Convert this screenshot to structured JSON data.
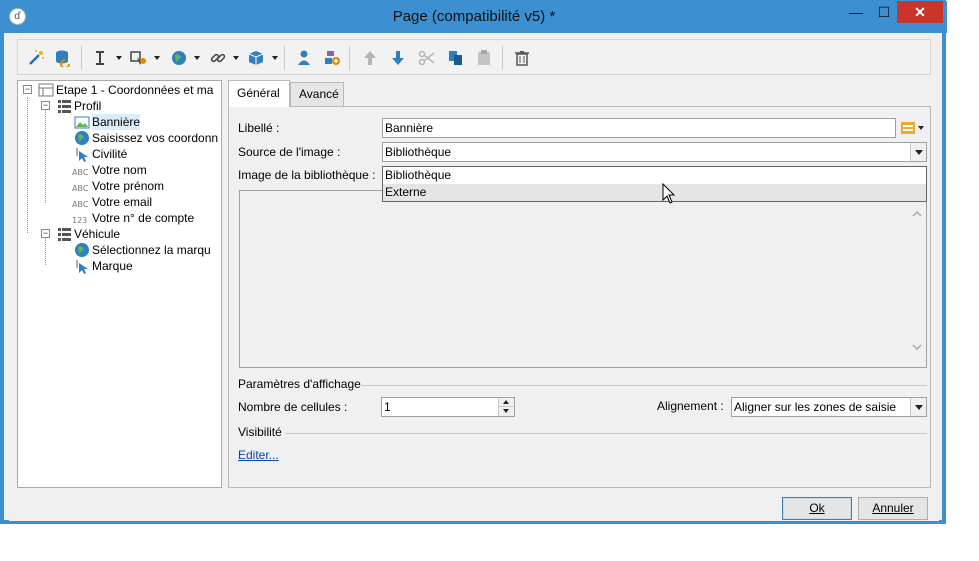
{
  "window": {
    "title": "Page (compatibilité v5) *",
    "app_icon_glyph": "ď",
    "controls": {
      "minimize": "—",
      "maximize": "☐",
      "close": "✕"
    }
  },
  "toolbar": {
    "icons": [
      "magic-wand-icon",
      "database-refresh-icon",
      "text-cursor-icon",
      "form-input-icon",
      "globe-icon",
      "link-icon",
      "box-icon",
      "user-icon",
      "add-component-icon",
      "arrow-up-icon",
      "arrow-down-icon",
      "scissors-icon",
      "copy-icon",
      "paste-icon",
      "delete-icon"
    ]
  },
  "tree": {
    "items": [
      {
        "label": "Etape 1 - Coordonnées et ma",
        "icon": "page-icon"
      },
      {
        "label": "Profil",
        "icon": "list-icon"
      },
      {
        "label": "Bannière",
        "icon": "image-icon"
      },
      {
        "label": "Saisissez vos coordonn",
        "icon": "globe-icon"
      },
      {
        "label": "Civilité",
        "icon": "select-cursor-icon"
      },
      {
        "label": "Votre nom",
        "icon": "abc-text-icon",
        "glyph": "ABC"
      },
      {
        "label": "Votre prénom",
        "icon": "abc-text-icon",
        "glyph": "ABC"
      },
      {
        "label": "Votre email",
        "icon": "abc-text-icon",
        "glyph": "ABC"
      },
      {
        "label": "Votre n° de compte",
        "icon": "number-icon",
        "glyph": "123"
      },
      {
        "label": "Véhicule",
        "icon": "list-icon"
      },
      {
        "label": "Sélectionnez la marqu",
        "icon": "globe-icon"
      },
      {
        "label": "Marque",
        "icon": "select-cursor-icon"
      }
    ],
    "expander_glyph": "−"
  },
  "tabs": [
    {
      "label": "Général",
      "active": true
    },
    {
      "label": "Avancé",
      "active": false
    }
  ],
  "form": {
    "libelle_label": "Libellé :",
    "libelle_value": "Bannière",
    "source_label": "Source de l'image :",
    "source_value": "Bibliothèque",
    "source_options": [
      "Bibliothèque",
      "Externe"
    ],
    "hovered_option": "Externe",
    "library_image_label": "Image de la bibliothèque :",
    "display_params_label": "Paramètres d'affichage",
    "cells_label": "Nombre de cellules :",
    "cells_value": "1",
    "alignment_label": "Alignement :",
    "alignment_value": "Aligner sur les zones de saisie",
    "visibility_label": "Visibilité",
    "edit_link": "Editer..."
  },
  "buttons": {
    "ok": "Ok",
    "cancel": "Annuler"
  },
  "colors": {
    "titlebar": "#3c8fd0",
    "close": "#c7352b",
    "link": "#0645ad",
    "selection": "#dcecf9",
    "dropdown_hover": "#e5e5e5"
  }
}
